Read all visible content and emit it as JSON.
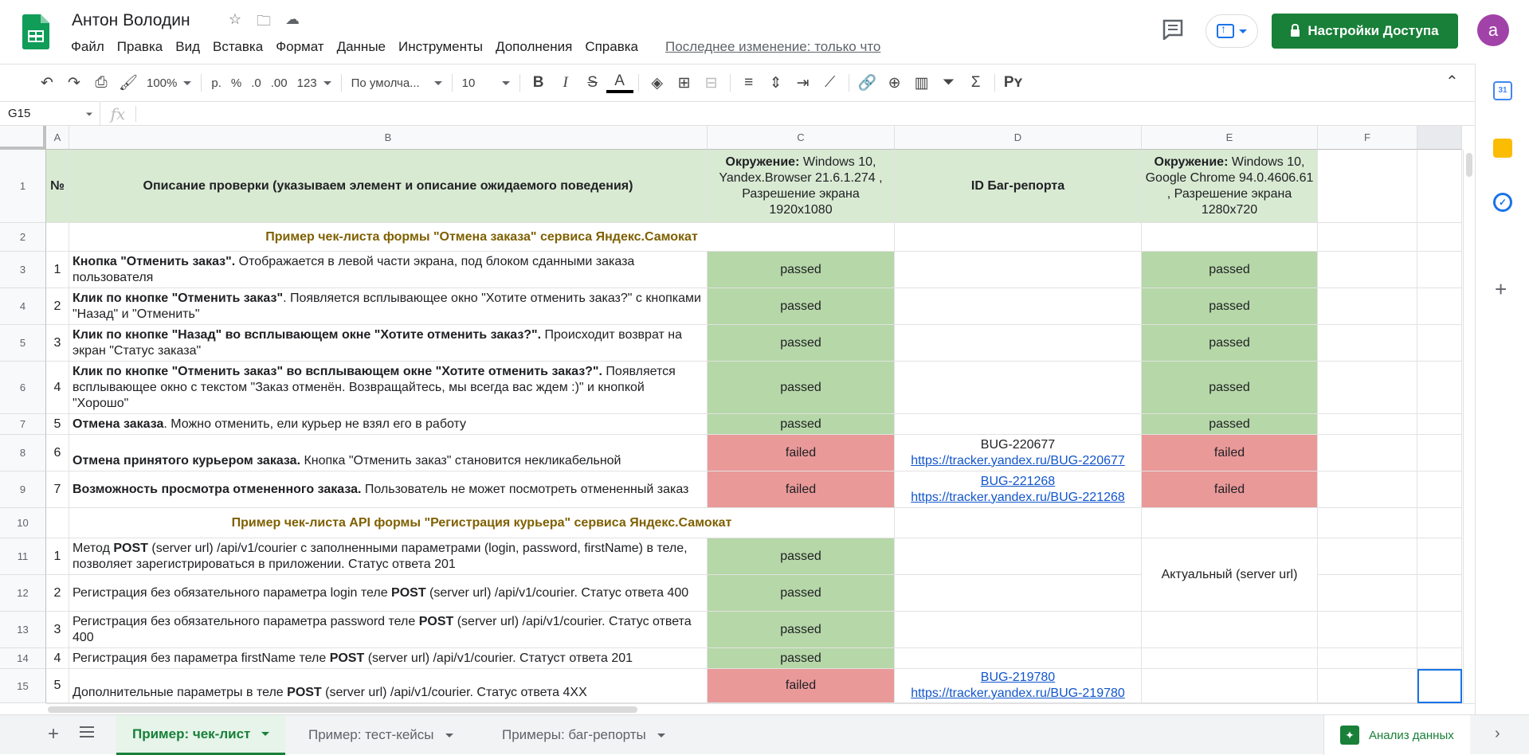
{
  "app": {
    "title": "Антон Володин",
    "menu": [
      "Файл",
      "Правка",
      "Вид",
      "Вставка",
      "Формат",
      "Данные",
      "Инструменты",
      "Дополнения",
      "Справка"
    ],
    "last_edit": "Последнее изменение: только что",
    "share_label": "Настройки Доступа",
    "avatar_letter": "a"
  },
  "toolbar": {
    "zoom": "100%",
    "currency": "р.",
    "percent": "%",
    "dec_less": ".0",
    "dec_more": ".00",
    "format": "123",
    "font": "По умолча...",
    "font_size": "10"
  },
  "formula": {
    "cell_ref": "G15",
    "fx": "fx",
    "value": ""
  },
  "columns": [
    "A",
    "B",
    "C",
    "D",
    "E",
    "F"
  ],
  "rows": [
    "1",
    "2",
    "3",
    "4",
    "5",
    "6",
    "7",
    "8",
    "9",
    "10",
    "11",
    "12",
    "13",
    "14",
    "15"
  ],
  "header": {
    "num": "№",
    "desc": "Описание проверки (указываем элемент и описание ожидаемого поведения)",
    "env1_label": "Окружение:",
    "env1_value": "Windows 10, Yandex.Browser 21.6.1.274 , Разрешение экрана 1920x1080",
    "bug_id": "ID Баг-репорта",
    "env2_label": "Окружение:",
    "env2_value": "Windows 10, Google Chrome 94.0.4606.61 , Разрешение экрана 1280x720"
  },
  "sections": {
    "s1": "Пример чек-листа формы \"Отмена заказа\" сервиса Яндекс.Самокат",
    "s2": "Пример чек-листа API формы \"Регистрация курьера\" сервиса Яндекс.Самокат"
  },
  "checks": [
    {
      "n": "1",
      "bold": "Кнопка \"Отменить заказ\".",
      "text": " Отображается в левой части экрана, под блоком  сданными заказа пользователя",
      "c": "passed",
      "d1": "",
      "d2": "",
      "e": "passed"
    },
    {
      "n": "2",
      "bold": "Клик по кнопке \"Отменить заказ\"",
      "text": ". Появляется всплывающее окно \"Хотите отменить заказ?\" с кнопками \"Назад\" и \"Отменить\"",
      "c": "passed",
      "d1": "",
      "d2": "",
      "e": "passed"
    },
    {
      "n": "3",
      "bold": "Клик по кнопке \"Назад\" во всплывающем окне \"Хотите отменить заказ?\".",
      "text": " Происходит возврат на экран \"Статус заказа\"",
      "c": "passed",
      "d1": "",
      "d2": "",
      "e": "passed"
    },
    {
      "n": "4",
      "bold": "Клик по кнопке \"Отменить заказ\" во всплывающем окне \"Хотите отменить заказ?\".",
      "text": " Появляется всплывающее окно с текстом \"Заказ отменён. Возвращайтесь, мы всегда вас ждем :)\" и кнопкой \"Хорошо\"",
      "c": "passed",
      "d1": "",
      "d2": "",
      "e": "passed"
    },
    {
      "n": "5",
      "bold": "Отмена заказа",
      "text": ". Можно отменить, ели курьер не взял его в работу",
      "c": "passed",
      "d1": "",
      "d2": "",
      "e": "passed"
    },
    {
      "n": "6",
      "bold": "Отмена принятого курьером заказа.",
      "text": " Кнопка \"Отменить заказ\" становится некликабельной",
      "c": "failed",
      "d1": "BUG-220677",
      "d2": "https://tracker.yandex.ru/BUG-220677",
      "e": "failed"
    },
    {
      "n": "7",
      "bold": "Возможность просмотра отмененного заказа.",
      "text": " Пользователь не может посмотреть отмененный заказ",
      "c": "failed",
      "d1": "BUG-221268",
      "d2": "https://tracker.yandex.ru/BUG-221268",
      "e": "failed"
    }
  ],
  "api": [
    {
      "n": "1",
      "pre": "Метод ",
      "bold": "POST",
      "text": " (server url) /api/v1/courier с заполненными параметрами (login, password, firstName) в теле, позволяет зарегистрироваться в приложении. Статус ответа 201",
      "c": "passed",
      "d1": "",
      "d2": ""
    },
    {
      "n": "2",
      "pre": "Регистрация без обязательного параметра login теле ",
      "bold": "POST",
      "text": " (server url) /api/v1/courier. Статус ответа 400",
      "c": "passed",
      "d1": "",
      "d2": ""
    },
    {
      "n": "3",
      "pre": "Регистрация без обязательного параметра password теле ",
      "bold": "POST",
      "text": " (server url) /api/v1/courier. Статус ответа 400",
      "c": "passed",
      "d1": "",
      "d2": ""
    },
    {
      "n": "4",
      "pre": "Регистрация без параметра firstName теле ",
      "bold": "POST",
      "text": " (server url) /api/v1/courier. Статуст ответа 201",
      "c": "passed",
      "d1": "",
      "d2": ""
    },
    {
      "n": "5",
      "pre": "Дополнительные  параметры в теле ",
      "bold": "POST",
      "text": " (server url) /api/v1/courier. Статус ответа 4XX",
      "c": "failed",
      "d1": "BUG-219780",
      "d2": "https://tracker.yandex.ru/BUG-219780"
    }
  ],
  "api_env_note": "Актуальный (server url)",
  "sheets": {
    "tabs": [
      "Пример: чек-лист",
      "Пример: тест-кейсы",
      "Примеры: баг-репорты"
    ],
    "active": 0,
    "explore": "Анализ данных"
  },
  "side_panel": {
    "calendar_day": "31"
  }
}
